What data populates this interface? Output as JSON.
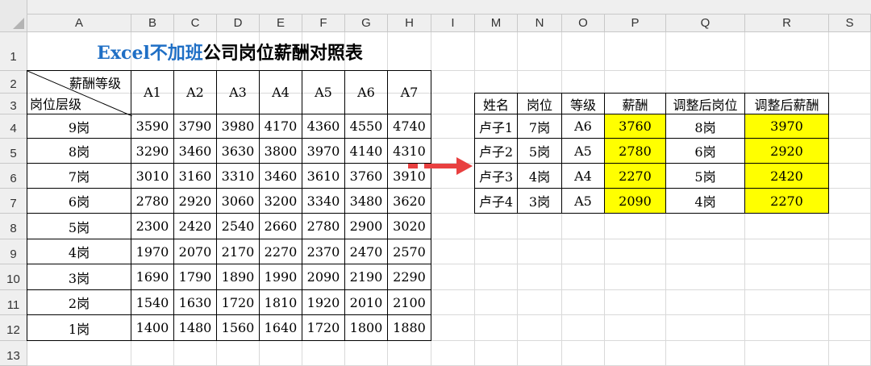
{
  "columns": [
    "A",
    "B",
    "C",
    "D",
    "E",
    "F",
    "G",
    "H",
    "I",
    "M",
    "N",
    "O",
    "P",
    "Q",
    "R",
    "S"
  ],
  "rows": [
    "1",
    "2",
    "3",
    "4",
    "5",
    "6",
    "7",
    "8",
    "9",
    "10",
    "11",
    "12",
    "13"
  ],
  "title": {
    "part1": "Excel不加班",
    "part2": "公司岗位薪酬对照表"
  },
  "left_table": {
    "header_top": "薪酬等级",
    "header_bottom": "岗位层级",
    "grades": [
      "A1",
      "A2",
      "A3",
      "A4",
      "A5",
      "A6",
      "A7"
    ],
    "rows": [
      {
        "post": "9岗",
        "vals": [
          "3590",
          "3790",
          "3980",
          "4170",
          "4360",
          "4550",
          "4740"
        ]
      },
      {
        "post": "8岗",
        "vals": [
          "3290",
          "3460",
          "3630",
          "3800",
          "3970",
          "4140",
          "4310"
        ]
      },
      {
        "post": "7岗",
        "vals": [
          "3010",
          "3160",
          "3310",
          "3460",
          "3610",
          "3760",
          "3910"
        ]
      },
      {
        "post": "6岗",
        "vals": [
          "2780",
          "2920",
          "3060",
          "3200",
          "3340",
          "3480",
          "3620"
        ]
      },
      {
        "post": "5岗",
        "vals": [
          "2300",
          "2420",
          "2540",
          "2660",
          "2780",
          "2900",
          "3020"
        ]
      },
      {
        "post": "4岗",
        "vals": [
          "1970",
          "2070",
          "2170",
          "2270",
          "2370",
          "2470",
          "2570"
        ]
      },
      {
        "post": "3岗",
        "vals": [
          "1690",
          "1790",
          "1890",
          "1990",
          "2090",
          "2190",
          "2290"
        ]
      },
      {
        "post": "2岗",
        "vals": [
          "1540",
          "1630",
          "1720",
          "1810",
          "1920",
          "2010",
          "2100"
        ]
      },
      {
        "post": "1岗",
        "vals": [
          "1400",
          "1480",
          "1560",
          "1640",
          "1720",
          "1800",
          "1880"
        ]
      }
    ]
  },
  "right_table": {
    "headers": [
      "姓名",
      "岗位",
      "等级",
      "薪酬",
      "调整后岗位",
      "调整后薪酬"
    ],
    "rows": [
      [
        "卢子1",
        "7岗",
        "A6",
        "3760",
        "8岗",
        "3970"
      ],
      [
        "卢子2",
        "5岗",
        "A5",
        "2780",
        "6岗",
        "2920"
      ],
      [
        "卢子3",
        "4岗",
        "A4",
        "2270",
        "5岗",
        "2420"
      ],
      [
        "卢子4",
        "3岗",
        "A5",
        "2090",
        "4岗",
        "2270"
      ]
    ],
    "highlight_color": "#ffff00"
  },
  "arrow_color": "#e84040"
}
